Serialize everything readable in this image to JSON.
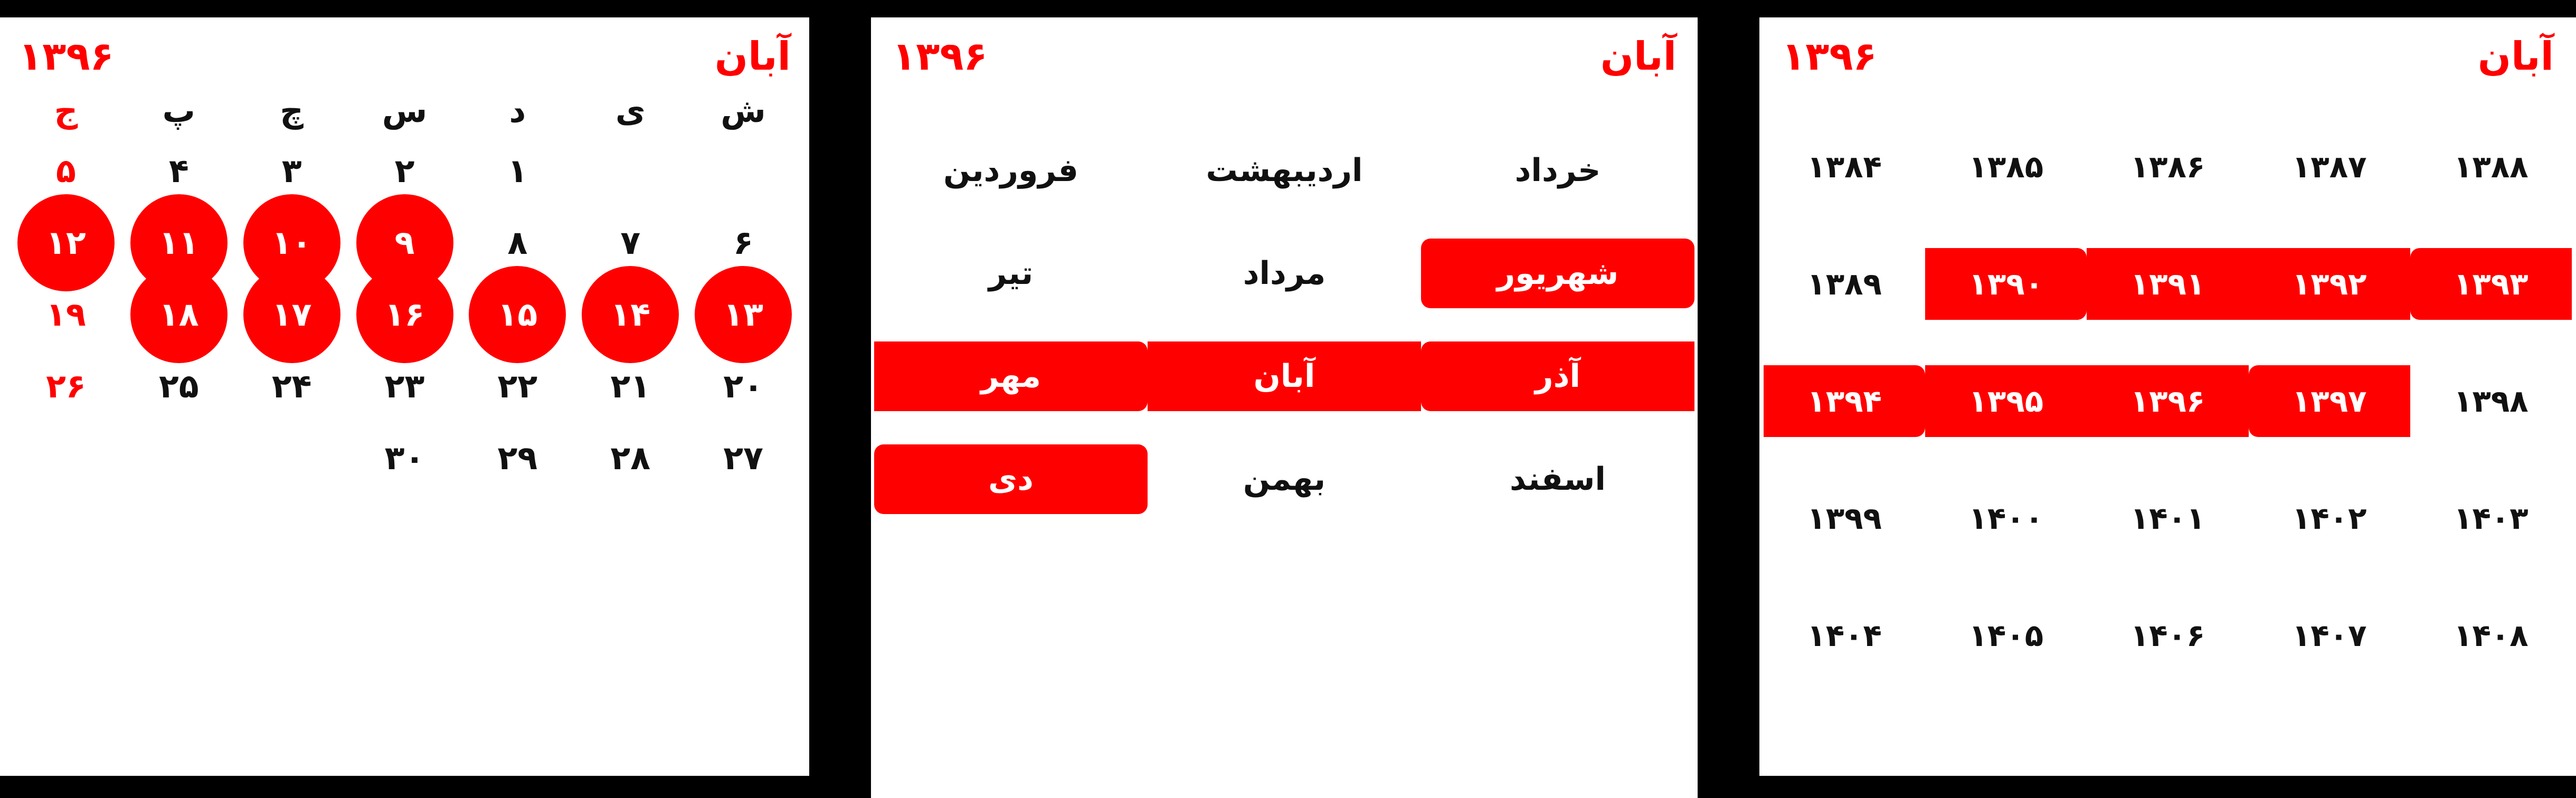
{
  "colors": {
    "accent": "#ff0000",
    "panel_bg": "#ffffff",
    "page_bg": "#000000",
    "text": "#111111",
    "selected_text": "#ffffff"
  },
  "day_panel": {
    "header": {
      "month": "آبان",
      "year": "۱۳۹۶"
    },
    "weekdays": [
      {
        "label": "ش",
        "holiday": false
      },
      {
        "label": "ی",
        "holiday": false
      },
      {
        "label": "د",
        "holiday": false
      },
      {
        "label": "س",
        "holiday": false
      },
      {
        "label": "چ",
        "holiday": false
      },
      {
        "label": "پ",
        "holiday": false
      },
      {
        "label": "ج",
        "holiday": true
      }
    ],
    "weeks": [
      [
        {
          "label": "",
          "empty": true,
          "selected": false,
          "holiday": false
        },
        {
          "label": "",
          "empty": true,
          "selected": false,
          "holiday": false
        },
        {
          "label": "۱",
          "empty": false,
          "selected": false,
          "holiday": false
        },
        {
          "label": "۲",
          "empty": false,
          "selected": false,
          "holiday": false
        },
        {
          "label": "۳",
          "empty": false,
          "selected": false,
          "holiday": false
        },
        {
          "label": "۴",
          "empty": false,
          "selected": false,
          "holiday": false
        },
        {
          "label": "۵",
          "empty": false,
          "selected": false,
          "holiday": true
        }
      ],
      [
        {
          "label": "۶",
          "empty": false,
          "selected": false,
          "holiday": false
        },
        {
          "label": "۷",
          "empty": false,
          "selected": false,
          "holiday": false
        },
        {
          "label": "۸",
          "empty": false,
          "selected": false,
          "holiday": false
        },
        {
          "label": "۹",
          "empty": false,
          "selected": true,
          "holiday": false
        },
        {
          "label": "۱۰",
          "empty": false,
          "selected": true,
          "holiday": false
        },
        {
          "label": "۱۱",
          "empty": false,
          "selected": true,
          "holiday": false
        },
        {
          "label": "۱۲",
          "empty": false,
          "selected": true,
          "holiday": true
        }
      ],
      [
        {
          "label": "۱۳",
          "empty": false,
          "selected": true,
          "holiday": false
        },
        {
          "label": "۱۴",
          "empty": false,
          "selected": true,
          "holiday": false
        },
        {
          "label": "۱۵",
          "empty": false,
          "selected": true,
          "holiday": false
        },
        {
          "label": "۱۶",
          "empty": false,
          "selected": true,
          "holiday": false
        },
        {
          "label": "۱۷",
          "empty": false,
          "selected": true,
          "holiday": false
        },
        {
          "label": "۱۸",
          "empty": false,
          "selected": true,
          "holiday": false
        },
        {
          "label": "۱۹",
          "empty": false,
          "selected": false,
          "holiday": true
        }
      ],
      [
        {
          "label": "۲۰",
          "empty": false,
          "selected": false,
          "holiday": false
        },
        {
          "label": "۲۱",
          "empty": false,
          "selected": false,
          "holiday": false
        },
        {
          "label": "۲۲",
          "empty": false,
          "selected": false,
          "holiday": false
        },
        {
          "label": "۲۳",
          "empty": false,
          "selected": false,
          "holiday": false
        },
        {
          "label": "۲۴",
          "empty": false,
          "selected": false,
          "holiday": false
        },
        {
          "label": "۲۵",
          "empty": false,
          "selected": false,
          "holiday": false
        },
        {
          "label": "۲۶",
          "empty": false,
          "selected": false,
          "holiday": true
        }
      ],
      [
        {
          "label": "۲۷",
          "empty": false,
          "selected": false,
          "holiday": false
        },
        {
          "label": "۲۸",
          "empty": false,
          "selected": false,
          "holiday": false
        },
        {
          "label": "۲۹",
          "empty": false,
          "selected": false,
          "holiday": false
        },
        {
          "label": "۳۰",
          "empty": false,
          "selected": false,
          "holiday": false
        },
        {
          "label": "",
          "empty": true,
          "selected": false,
          "holiday": false
        },
        {
          "label": "",
          "empty": true,
          "selected": false,
          "holiday": false
        },
        {
          "label": "",
          "empty": true,
          "selected": false,
          "holiday": false
        }
      ]
    ]
  },
  "month_panel": {
    "header": {
      "month": "آبان",
      "year": "۱۳۹۶"
    },
    "rows": [
      [
        {
          "label": "خرداد",
          "selected": false
        },
        {
          "label": "اردیبهشت",
          "selected": false
        },
        {
          "label": "فروردین",
          "selected": false
        }
      ],
      [
        {
          "label": "شهریور",
          "selected": true
        },
        {
          "label": "مرداد",
          "selected": false
        },
        {
          "label": "تیر",
          "selected": false
        }
      ],
      [
        {
          "label": "آذر",
          "selected": true
        },
        {
          "label": "آبان",
          "selected": true
        },
        {
          "label": "مهر",
          "selected": true
        }
      ],
      [
        {
          "label": "اسفند",
          "selected": false
        },
        {
          "label": "بهمن",
          "selected": false
        },
        {
          "label": "دی",
          "selected": true
        }
      ]
    ]
  },
  "year_panel": {
    "header": {
      "month": "آبان",
      "year": "۱۳۹۶"
    },
    "rows": [
      [
        {
          "label": "۱۳۸۸",
          "selected": false
        },
        {
          "label": "۱۳۸۷",
          "selected": false
        },
        {
          "label": "۱۳۸۶",
          "selected": false
        },
        {
          "label": "۱۳۸۵",
          "selected": false
        },
        {
          "label": "۱۳۸۴",
          "selected": false
        }
      ],
      [
        {
          "label": "۱۳۹۳",
          "selected": true
        },
        {
          "label": "۱۳۹۲",
          "selected": true
        },
        {
          "label": "۱۳۹۱",
          "selected": true
        },
        {
          "label": "۱۳۹۰",
          "selected": true
        },
        {
          "label": "۱۳۸۹",
          "selected": false
        }
      ],
      [
        {
          "label": "۱۳۹۸",
          "selected": false
        },
        {
          "label": "۱۳۹۷",
          "selected": true
        },
        {
          "label": "۱۳۹۶",
          "selected": true
        },
        {
          "label": "۱۳۹۵",
          "selected": true
        },
        {
          "label": "۱۳۹۴",
          "selected": true
        }
      ],
      [
        {
          "label": "۱۴۰۳",
          "selected": false
        },
        {
          "label": "۱۴۰۲",
          "selected": false
        },
        {
          "label": "۱۴۰۱",
          "selected": false
        },
        {
          "label": "۱۴۰۰",
          "selected": false
        },
        {
          "label": "۱۳۹۹",
          "selected": false
        }
      ],
      [
        {
          "label": "۱۴۰۸",
          "selected": false
        },
        {
          "label": "۱۴۰۷",
          "selected": false
        },
        {
          "label": "۱۴۰۶",
          "selected": false
        },
        {
          "label": "۱۴۰۵",
          "selected": false
        },
        {
          "label": "۱۴۰۴",
          "selected": false
        }
      ]
    ]
  }
}
